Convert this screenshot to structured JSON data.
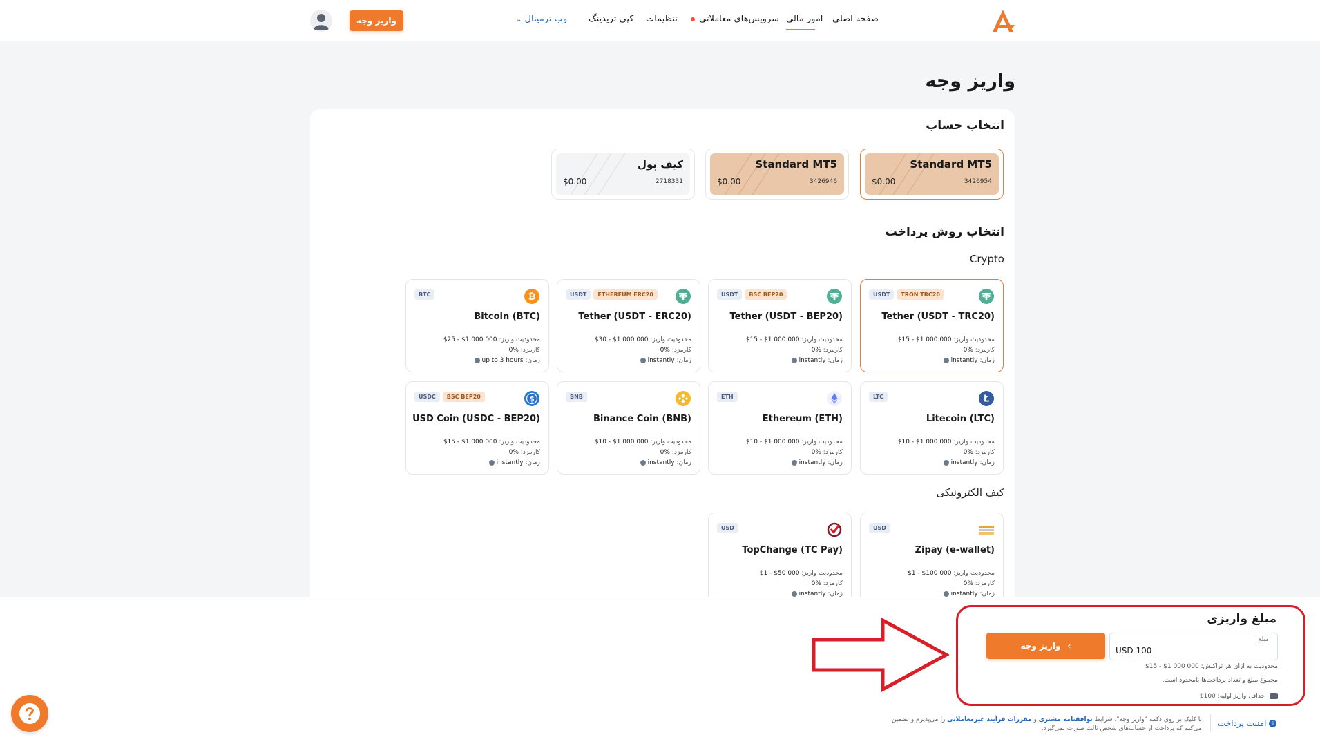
{
  "header": {
    "nav": {
      "home": "صفحه اصلی",
      "financial": "امور مالی",
      "trading_services": "سرویس‌های معاملاتی",
      "settings": "تنظیمات",
      "copy_trading": "کپی تریدینگ",
      "web_terminal": "وب ترمینال"
    },
    "deposit_button": "واریز وجه"
  },
  "page": {
    "title": "واریز وجه"
  },
  "account_section": {
    "title": "انتخاب حساب",
    "accounts": [
      {
        "name": "Standard MT5",
        "number": "3426954",
        "balance": "$0.00"
      },
      {
        "name": "Standard MT5",
        "number": "3426946",
        "balance": "$0.00"
      },
      {
        "name": "کیف پول",
        "number": "2718331",
        "balance": "$0.00"
      }
    ]
  },
  "payment_section": {
    "title": "انتخاب روش پرداخت",
    "crypto_label": "Crypto",
    "ewallet_label": "کیف الکترونیکی",
    "limit_label": "محدودیت واریز:",
    "fee_label": "کارمزد:",
    "time_label": "زمان:",
    "methods": [
      {
        "name": "Tether (USDT - TRC20)",
        "tags": [
          "USDT",
          "TRON TRC20"
        ],
        "icon": "tether-icon",
        "limit": "$15 - $1 000 000",
        "fee": "0%",
        "time": "instantly"
      },
      {
        "name": "Tether (USDT - BEP20)",
        "tags": [
          "USDT",
          "BSC BEP20"
        ],
        "icon": "tether-icon",
        "limit": "$15 - $1 000 000",
        "fee": "0%",
        "time": "instantly"
      },
      {
        "name": "Tether (USDT - ERC20)",
        "tags": [
          "USDT",
          "ETHEREUM ERC20"
        ],
        "icon": "tether-icon",
        "limit": "$30 - $1 000 000",
        "fee": "0%",
        "time": "instantly"
      },
      {
        "name": "Bitcoin (BTC)",
        "tags": [
          "BTC"
        ],
        "icon": "bitcoin-icon",
        "limit": "$25 - $1 000 000",
        "fee": "0%",
        "time": "up to 3 hours"
      },
      {
        "name": "Litecoin (LTC)",
        "tags": [
          "LTC"
        ],
        "icon": "litecoin-icon",
        "limit": "$10 - $1 000 000",
        "fee": "0%",
        "time": "instantly"
      },
      {
        "name": "Ethereum (ETH)",
        "tags": [
          "ETH"
        ],
        "icon": "ethereum-icon",
        "limit": "$10 - $1 000 000",
        "fee": "0%",
        "time": "instantly"
      },
      {
        "name": "Binance Coin (BNB)",
        "tags": [
          "BNB"
        ],
        "icon": "bnb-icon",
        "limit": "$10 - $1 000 000",
        "fee": "0%",
        "time": "instantly"
      },
      {
        "name": "USD Coin (USDC - BEP20)",
        "tags": [
          "USDC",
          "BSC BEP20"
        ],
        "icon": "usdc-icon",
        "limit": "$15 - $1 000 000",
        "fee": "0%",
        "time": "instantly"
      },
      {
        "name": "Zipay (e-wallet)",
        "tags": [
          "USD"
        ],
        "icon": "zipay-icon",
        "limit": "$1 - $100 000",
        "fee": "0%",
        "time": "instantly"
      },
      {
        "name": "TopChange (TC Pay)",
        "tags": [
          "USD"
        ],
        "icon": "topchange-icon",
        "limit": "$1 - $50 000",
        "fee": "0%",
        "time": "instantly"
      }
    ]
  },
  "amount_panel": {
    "title": "مبلغ واریزی",
    "input_label": "مبلغ",
    "input_value": "USD 100",
    "button_label": "واریز وجه",
    "limit_note_prefix": "محدودیت به ازای هر تراکنش:",
    "limit_note_value": "$15 - $1 000 000",
    "total_note": "مجموع مبلغ و تعداد پرداخت‌ها نامحدود است.",
    "min_note": "حداقل واریز اولیه: 100$"
  },
  "footer": {
    "security": "امنیت پرداخت",
    "terms_1": "با کلیک بر روی دکمه \"واریز وجه\"، شرایط",
    "terms_link1": "توافقنامه مشتری",
    "terms_and": "و",
    "terms_link2": "مقررات فرآیند غیرمعاملاتی",
    "terms_2": "را می‌پذیرم و تضمین می‌کنم که پرداخت از حساب‌های شخص ثالث صورت نمی‌گیرد."
  },
  "colors": {
    "accent": "#f07a2b",
    "highlight_red": "#d81e28",
    "link": "#2a67b8"
  }
}
